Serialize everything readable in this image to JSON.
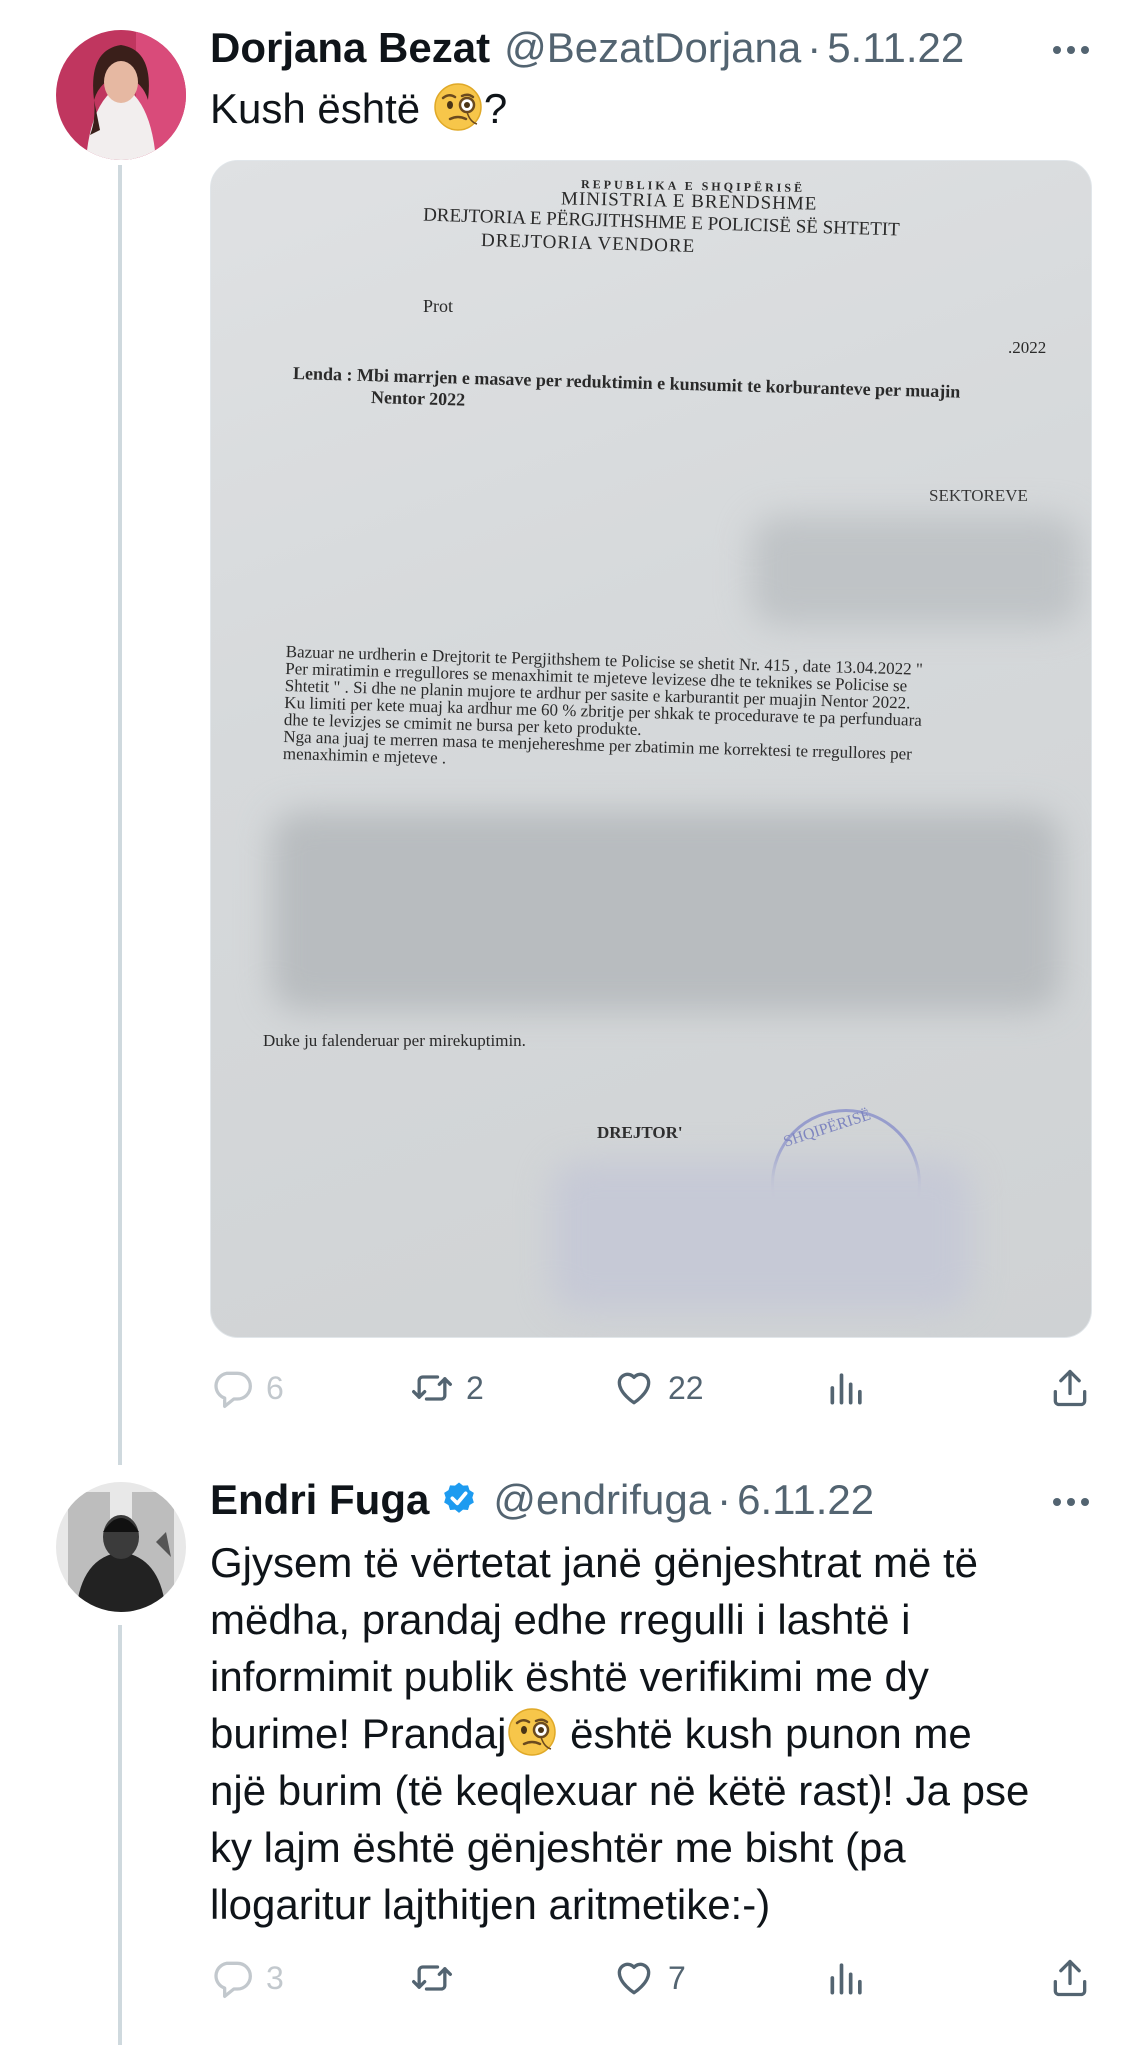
{
  "tweets": [
    {
      "name": "Dorjana Bezat",
      "handle": "@BezatDorjana",
      "date": "5.11.22",
      "text_before_emoji": "Kush është ",
      "emoji": "face-with-monocle",
      "text_after_emoji": "?",
      "actions": {
        "replies": "6",
        "retweets": "2",
        "likes": "22"
      },
      "document": {
        "line1": "REPUBLIKA E SHQIPËRISË",
        "line2": "MINISTRIA E BRENDSHME",
        "line3": "DREJTORIA E PËRGJITHSHME E POLICISË SË SHTETIT",
        "line4": "DREJTORIA  VENDORE",
        "prot": "Prot",
        "date": ".2022",
        "subject_line1": "Lenda : Mbi marrjen e masave per reduktimin e kunsumit te korburanteve per muajin",
        "subject_line2": "Nentor 2022",
        "addressee": "SEKTOREVE",
        "body": [
          "Bazuar ne urdherin e Drejtorit te Pergjithshem te Policise se shetit Nr. 415 , date 13.04.2022 \"",
          "Per miratimin e rregullores se menaxhimit te mjeteve levizese dhe te teknikes se Policise se",
          "Shtetit \" . Si dhe ne planin mujore te ardhur per sasite e karburantit per muajin Nentor 2022.",
          "Ku limiti per kete muaj ka ardhur me 60 % zbritje per shkak te procedurave te pa perfunduara",
          "dhe te levizjes se cmimit ne bursa per keto produkte.",
          "Nga ana juaj te merren masa te menjehereshme per zbatimin me korrektesi te rregullores per",
          "menaxhimin e mjeteve ."
        ],
        "closing": "Duke ju falenderuar per mirekuptimin.",
        "signature": "DREJTOR'",
        "stamp": "SHQIPËRISË"
      }
    },
    {
      "name": "Endri Fuga",
      "handle": "@endrifuga",
      "date": "6.11.22",
      "verified": true,
      "lines": [
        "Gjysem të vërtetat janë gënjeshtrat më të",
        "mëdha, prandaj edhe rregulli i lashtë i",
        "informimit publik është verifikimi me dy"
      ],
      "line4_before_emoji": "burime! Prandaj",
      "emoji": "face-with-monocle",
      "line4_after_emoji": " është kush punon me",
      "lines_after": [
        "një burim (të keqlexuar në këtë rast)! Ja pse",
        "ky lajm është gënjeshtër me bisht (pa",
        "llogaritur lajthitjen aritmetike:-)"
      ],
      "actions": {
        "replies": "3",
        "retweets": "",
        "likes": "7"
      }
    }
  ],
  "icons": [
    "reply-icon",
    "retweet-icon",
    "like-icon",
    "views-icon",
    "share-icon",
    "more-icon",
    "verified-badge-icon"
  ],
  "colors": {
    "text": "#0f1419",
    "secondary": "#536471",
    "verified": "#1d9bf0",
    "thread_line": "#cfd9de"
  }
}
